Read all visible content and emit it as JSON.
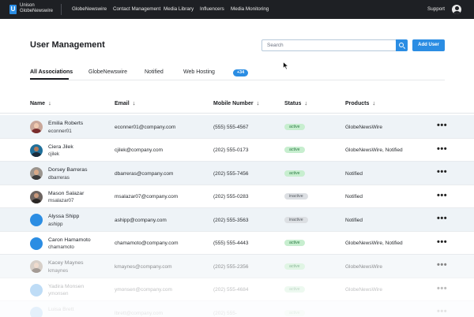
{
  "topnav": {
    "brand_line1": "Unison",
    "brand_line2": "GlobeNewswire",
    "logo_letter": "U",
    "items": [
      "GlobeNewswire",
      "Contact Management",
      "Media Library",
      "Influencers",
      "Media Monitoring"
    ],
    "support": "Support",
    "account_icon": "user-circle-icon"
  },
  "header": {
    "title": "User Management",
    "search_placeholder": "Search",
    "search_icon": "search-icon",
    "add_button": "Add User"
  },
  "tabs": {
    "items": [
      "All Associations",
      "GlobeNewswire",
      "Notified",
      "Web Hosting"
    ],
    "active": "All Associations",
    "more_count": "+34"
  },
  "table": {
    "columns": [
      "Name",
      "Email",
      "Mobile Number",
      "Status",
      "Products"
    ],
    "sort_icon": "arrow-down-icon",
    "row_menu_icon": "ellipsis-icon",
    "rows": [
      {
        "name": "Emilia Roberts",
        "username": "econner01",
        "email": "econner01@company.com",
        "phone": "(555) 555-4567",
        "status": "active",
        "products": "GlobeNewsWire"
      },
      {
        "name": "Ciera Jilek",
        "username": "cjilek",
        "email": "cjilek@company.com",
        "phone": "(202) 555-0173",
        "status": "active",
        "products": "GlobeNewsWire, Notified"
      },
      {
        "name": "Dorsey Barreras",
        "username": "dbarreras",
        "email": "dbarreras@company.com",
        "phone": "(202) 555-7456",
        "status": "active",
        "products": "Notified"
      },
      {
        "name": "Mason Salazar",
        "username": "msalazar07",
        "email": "msalazar07@company.com",
        "phone": "(202) 555-0283",
        "status": "inactive",
        "products": "Notified"
      },
      {
        "name": "Alyssa Shipp",
        "username": "ashipp",
        "email": "ashipp@company.com",
        "phone": "(202) 555-3563",
        "status": "inactive",
        "products": "Notified"
      },
      {
        "name": "Caron Hamamoto",
        "username": "chamamoto",
        "email": "chamamoto@company.com",
        "phone": "(555) 555-4443",
        "status": "active",
        "products": "GlobeNewsWire, Notified"
      },
      {
        "name": "Kacey Maynes",
        "username": "kmaynes",
        "email": "kmaynes@company.com",
        "phone": "(202) 555-2356",
        "status": "active",
        "products": "GlobeNewsWire"
      },
      {
        "name": "Yadira Monsen",
        "username": "ymonsen",
        "email": "ymonsen@company.com",
        "phone": "(202) 555-4684",
        "status": "active",
        "products": "GlobeNewsWire"
      },
      {
        "name": "Luisa Brett",
        "username": "",
        "email": "lbrett@company.com",
        "phone": "(202) 555-",
        "status": "active",
        "products": ""
      }
    ]
  },
  "colors": {
    "accent": "#2b8de3",
    "nav_bg": "#1e2024",
    "active_bg": "#c7eecf",
    "active_text": "#2e7d46",
    "inactive_bg": "#dcdfe3",
    "row_alt": "#eef3f7"
  }
}
